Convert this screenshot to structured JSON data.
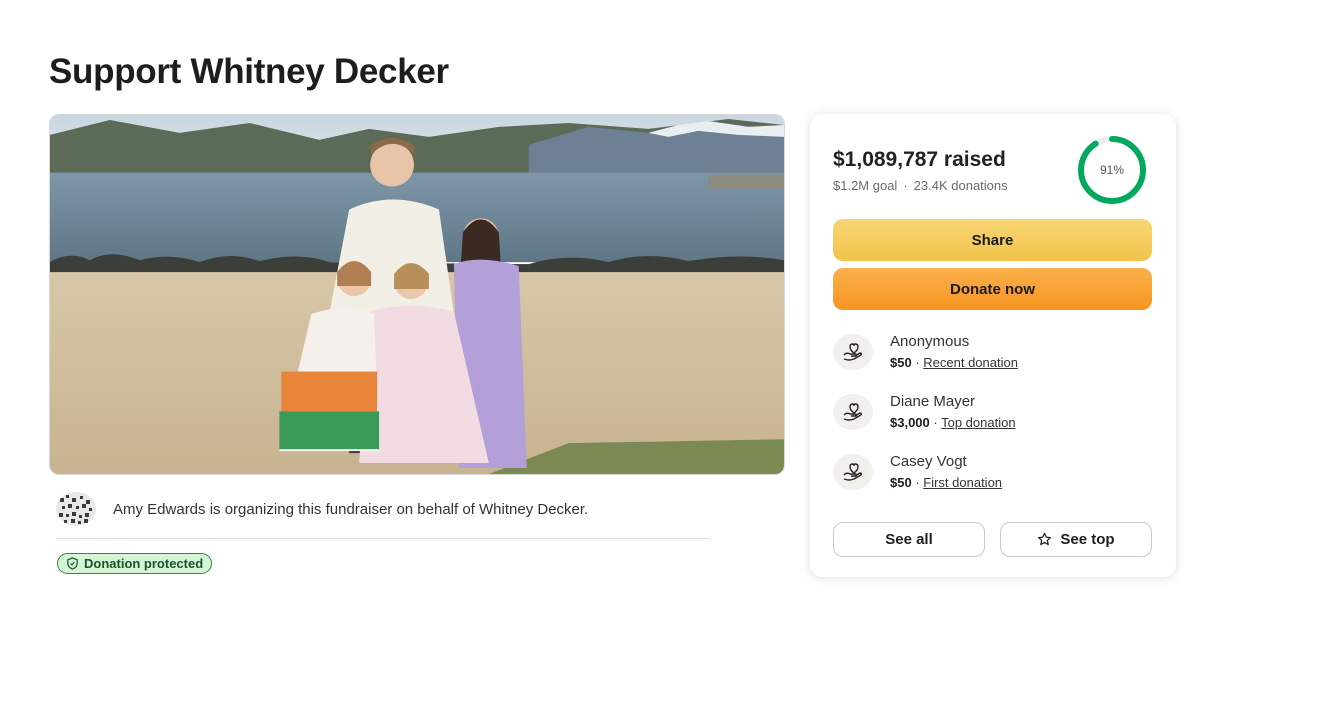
{
  "page": {
    "title": "Support Whitney Decker"
  },
  "hero": {
    "image": "family-photo-beach-lake"
  },
  "organizer": {
    "text": "Amy Edwards is organizing this fundraiser on behalf of Whitney Decker."
  },
  "badge": {
    "label": "Donation protected",
    "icon": "shield-icon"
  },
  "card": {
    "raised": "$1,089,787 raised",
    "goal": "$1.2M goal",
    "separator": "·",
    "donations": "23.4K donations",
    "progress_label": "91%",
    "progress_fraction": 0.91,
    "share_label": "Share",
    "donate_label": "Donate now",
    "donors": [
      {
        "name": "Anonymous",
        "amount": "$50",
        "tag": "Recent donation"
      },
      {
        "name": "Diane Mayer",
        "amount": "$3,000",
        "tag": "Top donation"
      },
      {
        "name": "Casey Vogt",
        "amount": "$50",
        "tag": "First donation"
      }
    ],
    "see_all_label": "See all",
    "see_top_label": "See top"
  },
  "colors": {
    "progress": "#02a95c",
    "share_button": "#f2c34a",
    "donate_button": "#f79422",
    "badge_bg": "#d4f5d6"
  }
}
